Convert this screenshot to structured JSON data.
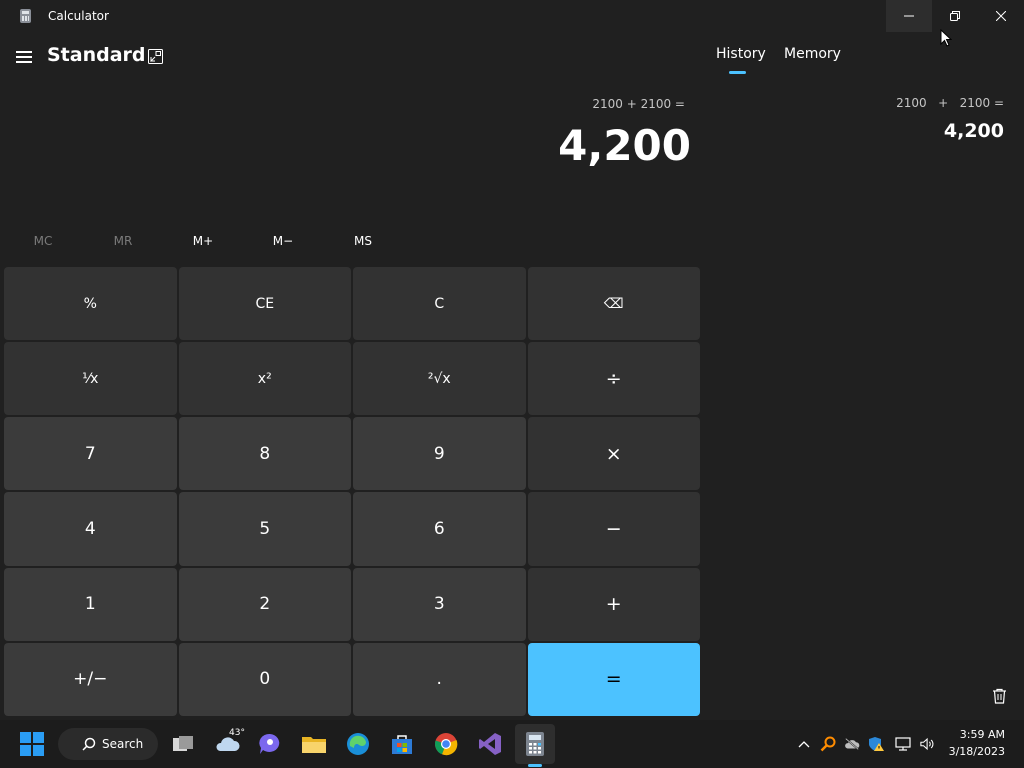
{
  "window": {
    "title": "Calculator",
    "icon": "calculator-icon",
    "controls": [
      "minimize-icon",
      "restore-icon",
      "close-icon"
    ]
  },
  "header": {
    "menu_icon": "hamburger-icon",
    "mode": "Standard",
    "keep_on_top_icon": "keep-on-top-icon"
  },
  "display": {
    "expression": "2100 + 2100 =",
    "result": "4,200"
  },
  "memory": {
    "buttons": [
      {
        "label": "MC",
        "enabled": false
      },
      {
        "label": "MR",
        "enabled": false
      },
      {
        "label": "M+",
        "enabled": true
      },
      {
        "label": "M−",
        "enabled": true
      },
      {
        "label": "MS",
        "enabled": true
      }
    ]
  },
  "keypad": {
    "keys": [
      {
        "label": "%",
        "name": "percent-key",
        "kind": "fn"
      },
      {
        "label": "CE",
        "name": "clear-entry-key",
        "kind": "fn"
      },
      {
        "label": "C",
        "name": "clear-key",
        "kind": "fn"
      },
      {
        "label": "⌫",
        "name": "backspace-key",
        "kind": "fn"
      },
      {
        "label": "⅟x",
        "name": "reciprocal-key",
        "kind": "fn"
      },
      {
        "label": "x²",
        "name": "square-key",
        "kind": "fn"
      },
      {
        "label": "²√x",
        "name": "square-root-key",
        "kind": "fn"
      },
      {
        "label": "÷",
        "name": "divide-key",
        "kind": "op"
      },
      {
        "label": "7",
        "name": "digit-7-key",
        "kind": "num"
      },
      {
        "label": "8",
        "name": "digit-8-key",
        "kind": "num"
      },
      {
        "label": "9",
        "name": "digit-9-key",
        "kind": "num"
      },
      {
        "label": "×",
        "name": "multiply-key",
        "kind": "op"
      },
      {
        "label": "4",
        "name": "digit-4-key",
        "kind": "num"
      },
      {
        "label": "5",
        "name": "digit-5-key",
        "kind": "num"
      },
      {
        "label": "6",
        "name": "digit-6-key",
        "kind": "num"
      },
      {
        "label": "−",
        "name": "subtract-key",
        "kind": "op"
      },
      {
        "label": "1",
        "name": "digit-1-key",
        "kind": "num"
      },
      {
        "label": "2",
        "name": "digit-2-key",
        "kind": "num"
      },
      {
        "label": "3",
        "name": "digit-3-key",
        "kind": "num"
      },
      {
        "label": "+",
        "name": "add-key",
        "kind": "op"
      },
      {
        "label": "+/−",
        "name": "negate-key",
        "kind": "num"
      },
      {
        "label": "0",
        "name": "digit-0-key",
        "kind": "num"
      },
      {
        "label": ".",
        "name": "decimal-key",
        "kind": "num"
      },
      {
        "label": "=",
        "name": "equals-key",
        "kind": "eq"
      }
    ]
  },
  "side_panel": {
    "tabs": [
      {
        "label": "History",
        "selected": true
      },
      {
        "label": "Memory",
        "selected": false
      }
    ],
    "history": [
      {
        "expression": "2100   +   2100 =",
        "result": "4,200"
      }
    ],
    "clear_icon": "trash-icon"
  },
  "taskbar": {
    "start_icon": "windows-start-icon",
    "search_label": "Search",
    "weather_temp": "43°",
    "apps": [
      "task-view-icon",
      "weather-icon",
      "teams-chat-icon",
      "file-explorer-icon",
      "edge-icon",
      "store-icon",
      "chrome-icon",
      "visual-studio-icon",
      "calculator-icon"
    ],
    "active_app": "calculator-icon",
    "tray_icons": [
      "show-hidden-icons-chevron-icon",
      "search-magnifier-icon",
      "cloud-offline-icon",
      "security-warning-icon",
      "network-icon",
      "volume-icon"
    ],
    "time": "3:59 AM",
    "date": "3/18/2023"
  },
  "colors": {
    "background": "#202020",
    "key_number": "#3b3b3b",
    "key_function": "#323232",
    "accent": "#4cc2ff",
    "taskbar": "#1c1c1c"
  }
}
